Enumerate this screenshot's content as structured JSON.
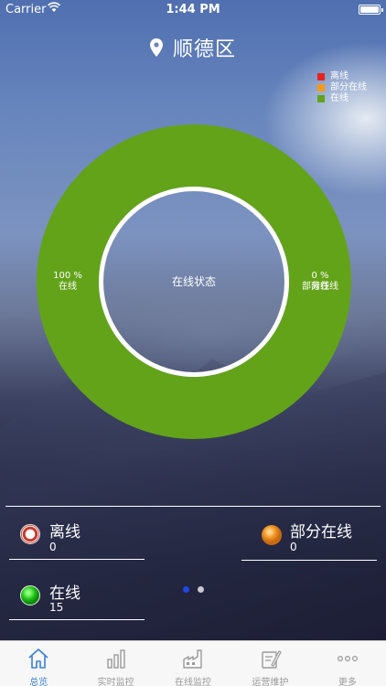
{
  "status_bar": {
    "carrier": "Carrier",
    "time": "1:44 PM"
  },
  "header": {
    "title": "顺德区"
  },
  "legend": [
    {
      "label": "离线",
      "color": "#e8231f"
    },
    {
      "label": "部分在线",
      "color": "#f59a1b"
    },
    {
      "label": "在线",
      "color": "#63a31a"
    }
  ],
  "chart_data": {
    "type": "pie",
    "title": "在线状态",
    "categories": [
      "离线",
      "部分在线",
      "在线"
    ],
    "values": [
      0,
      0,
      15
    ],
    "percent_labels": {
      "online": "100 %",
      "partial": "0 %"
    },
    "colors": [
      "#e8231f",
      "#f59a1b",
      "#63a31a"
    ],
    "donut": true,
    "legend_position": "top-right"
  },
  "stats": {
    "offline": {
      "label": "离线",
      "value": "0"
    },
    "partial": {
      "label": "部分在线",
      "value": "0"
    },
    "online": {
      "label": "在线",
      "value": "15"
    }
  },
  "pager": {
    "pages": 2,
    "current": 1
  },
  "tabs": [
    {
      "label": "总览",
      "icon": "home-icon",
      "active": true
    },
    {
      "label": "实时监控",
      "icon": "bar-chart-icon",
      "active": false
    },
    {
      "label": "在线监控",
      "icon": "factory-icon",
      "active": false
    },
    {
      "label": "运营维护",
      "icon": "maintenance-icon",
      "active": false
    },
    {
      "label": "更多",
      "icon": "more-icon",
      "active": false
    }
  ]
}
